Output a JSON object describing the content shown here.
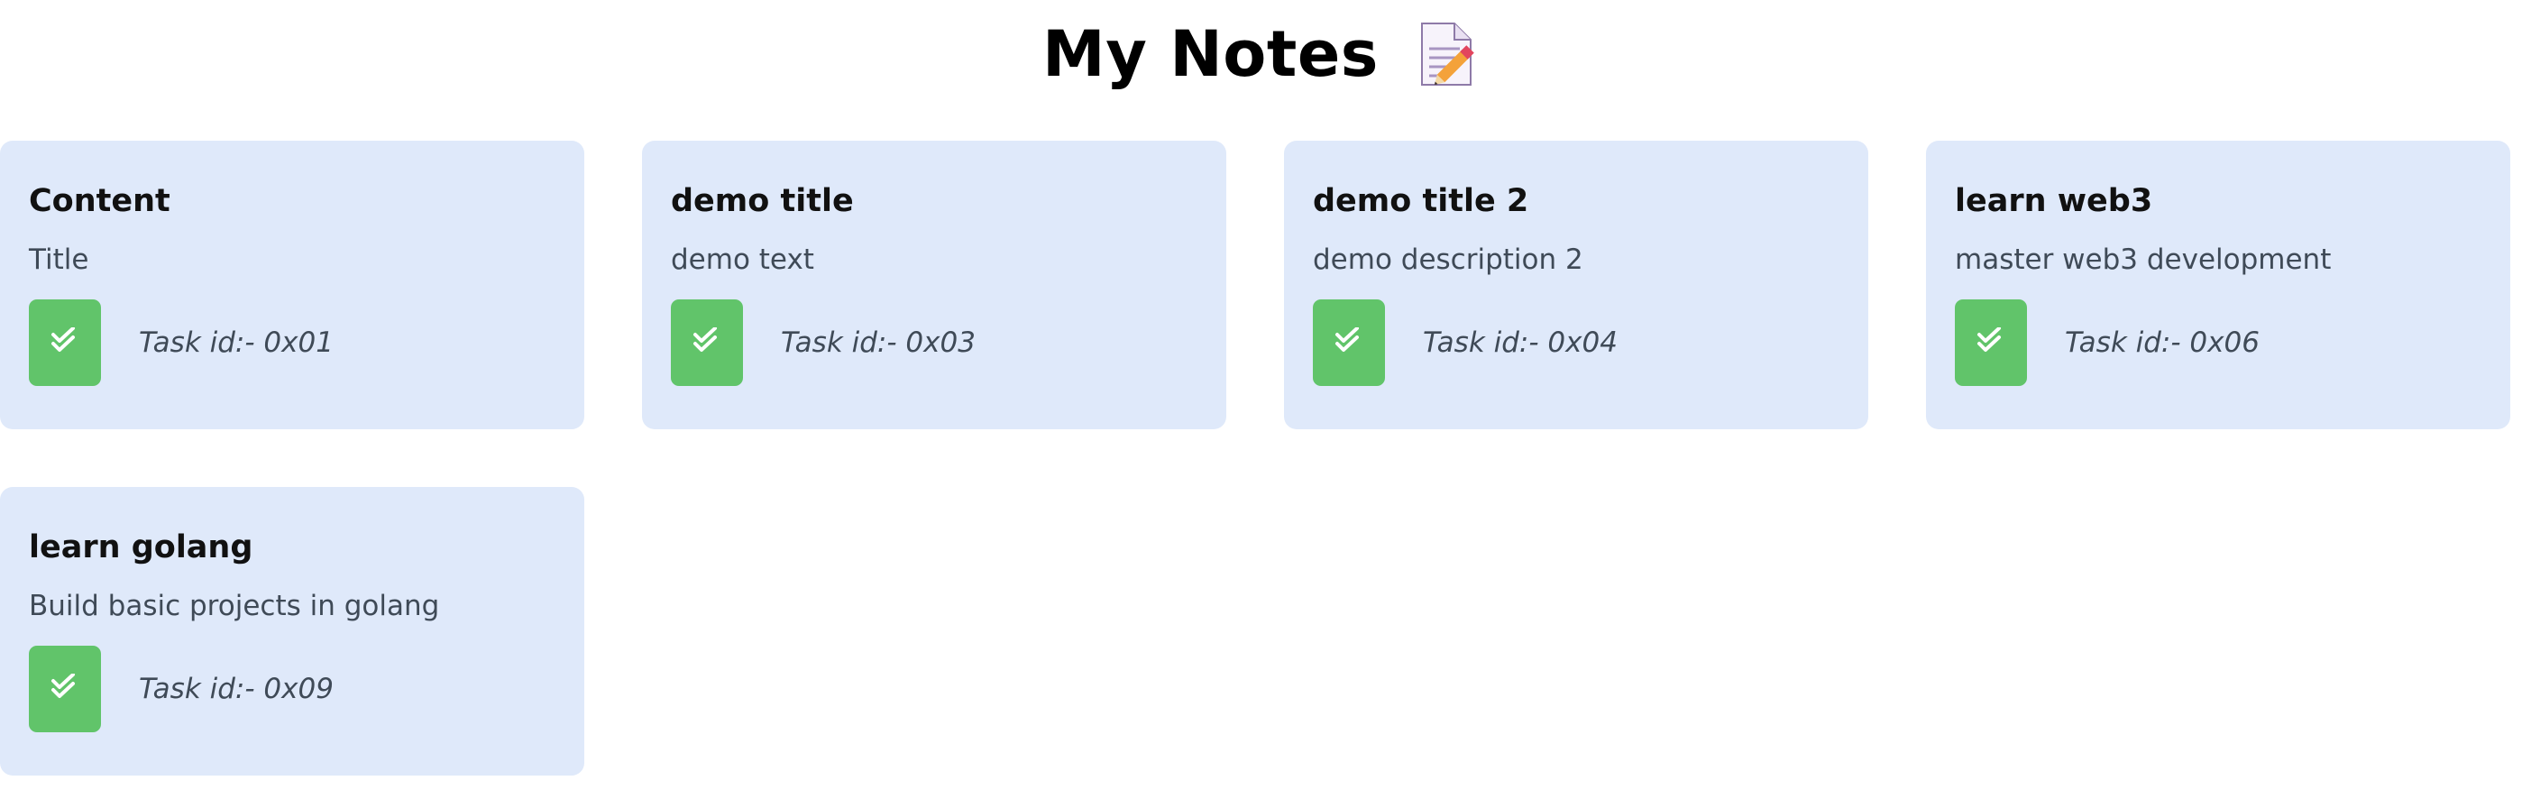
{
  "header": {
    "title": "My Notes",
    "icon": "memo-icon"
  },
  "colors": {
    "card_background": "#dfe9fa",
    "done_button": "#61c46a",
    "text_muted": "#3f4a57"
  },
  "notes": [
    {
      "title": "Content",
      "description": "Title",
      "task_id": "Task id:- 0x01",
      "icon": "double-check-icon"
    },
    {
      "title": "demo title",
      "description": "demo text",
      "task_id": "Task id:- 0x03",
      "icon": "double-check-icon"
    },
    {
      "title": "demo title 2",
      "description": "demo description 2",
      "task_id": "Task id:- 0x04",
      "icon": "double-check-icon"
    },
    {
      "title": "learn web3",
      "description": "master web3 development",
      "task_id": "Task id:- 0x06",
      "icon": "double-check-icon"
    },
    {
      "title": "learn golang",
      "description": "Build basic projects in golang",
      "task_id": "Task id:- 0x09",
      "icon": "double-check-icon"
    }
  ]
}
